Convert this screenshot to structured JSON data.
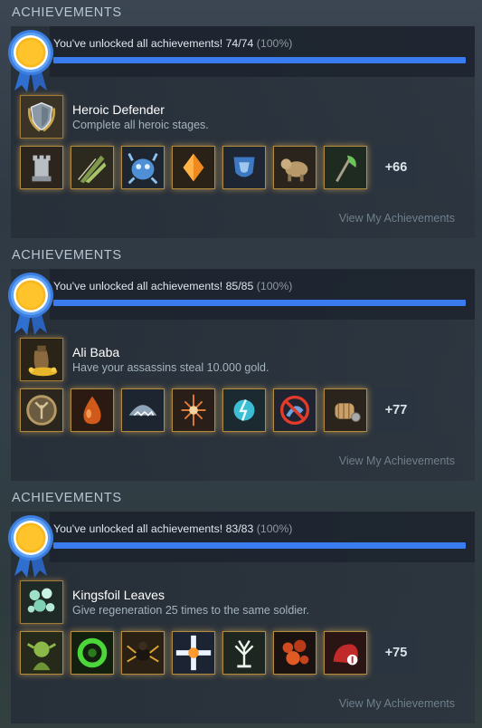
{
  "sections": [
    {
      "title": "ACHIEVEMENTS",
      "unlock_text": "You've unlocked all achievements! 74/74",
      "percent_text": "(100%)",
      "progress": 1.0,
      "feature": {
        "name": "Heroic Defender",
        "description": "Complete all heroic stages.",
        "icon": "shield-laurel-icon"
      },
      "icons": [
        "chess-rook-icon",
        "feather-blades-icon",
        "blue-creature-icon",
        "orange-crystal-icon",
        "blue-banner-icon",
        "beast-icon",
        "green-axe-icon"
      ],
      "more_label": "+66",
      "view_label": "View My Achievements"
    },
    {
      "title": "ACHIEVEMENTS",
      "unlock_text": "You've unlocked all achievements! 85/85",
      "percent_text": "(100%)",
      "progress": 1.0,
      "feature": {
        "name": "Ali Baba",
        "description": "Have your assassins steal 10.000 gold.",
        "icon": "gold-sack-icon"
      },
      "icons": [
        "tree-emblem-icon",
        "blood-drop-icon",
        "shark-icon",
        "sword-burst-icon",
        "lightning-orb-icon",
        "no-horn-icon",
        "fist-icon"
      ],
      "more_label": "+77",
      "view_label": "View My Achievements"
    },
    {
      "title": "ACHIEVEMENTS",
      "unlock_text": "You've unlocked all achievements! 83/83",
      "percent_text": "(100%)",
      "progress": 1.0,
      "feature": {
        "name": "Kingsfoil Leaves",
        "description": "Give regeneration 25 times to the same soldier.",
        "icon": "kingsfoil-leaves-icon"
      },
      "icons": [
        "goblin-icon",
        "green-ring-icon",
        "spider-icon",
        "light-cross-icon",
        "white-tree-icon",
        "lava-rocks-icon",
        "red-beast-icon"
      ],
      "more_label": "+75",
      "view_label": "View My Achievements"
    }
  ],
  "colors": {
    "progress_fill": "#3a7bf0",
    "ribbon_blue": "#2f6fd0",
    "ribbon_gold": "#f6b81d"
  }
}
